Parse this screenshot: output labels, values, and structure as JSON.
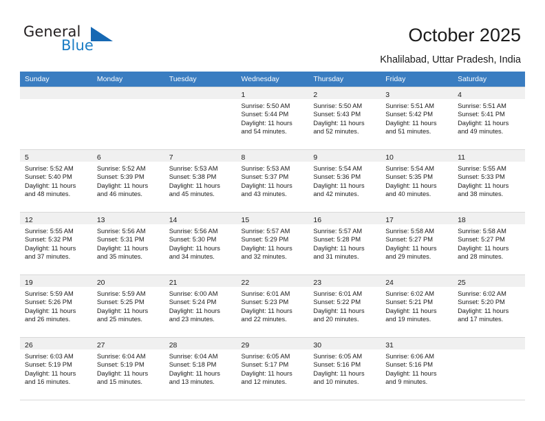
{
  "brand": {
    "general_text": "General",
    "blue_text": "Blue",
    "triangle_icon": "triangle-icon",
    "accent_color": "#1668b3"
  },
  "header": {
    "title": "October 2025",
    "location": "Khalilabad, Uttar Pradesh, India",
    "header_bg_color": "#3a7dc1"
  },
  "calendar": {
    "weekdays": [
      "Sunday",
      "Monday",
      "Tuesday",
      "Wednesday",
      "Thursday",
      "Friday",
      "Saturday"
    ],
    "labels": {
      "sunrise": "Sunrise:",
      "sunset": "Sunset:",
      "daylight": "Daylight:"
    },
    "weeks": [
      [
        {
          "day": "",
          "sunrise": "",
          "sunset": "",
          "daylight_1": "",
          "daylight_2": ""
        },
        {
          "day": "",
          "sunrise": "",
          "sunset": "",
          "daylight_1": "",
          "daylight_2": ""
        },
        {
          "day": "",
          "sunrise": "",
          "sunset": "",
          "daylight_1": "",
          "daylight_2": ""
        },
        {
          "day": "1",
          "sunrise": "Sunrise: 5:50 AM",
          "sunset": "Sunset: 5:44 PM",
          "daylight_1": "Daylight: 11 hours",
          "daylight_2": "and 54 minutes."
        },
        {
          "day": "2",
          "sunrise": "Sunrise: 5:50 AM",
          "sunset": "Sunset: 5:43 PM",
          "daylight_1": "Daylight: 11 hours",
          "daylight_2": "and 52 minutes."
        },
        {
          "day": "3",
          "sunrise": "Sunrise: 5:51 AM",
          "sunset": "Sunset: 5:42 PM",
          "daylight_1": "Daylight: 11 hours",
          "daylight_2": "and 51 minutes."
        },
        {
          "day": "4",
          "sunrise": "Sunrise: 5:51 AM",
          "sunset": "Sunset: 5:41 PM",
          "daylight_1": "Daylight: 11 hours",
          "daylight_2": "and 49 minutes."
        }
      ],
      [
        {
          "day": "5",
          "sunrise": "Sunrise: 5:52 AM",
          "sunset": "Sunset: 5:40 PM",
          "daylight_1": "Daylight: 11 hours",
          "daylight_2": "and 48 minutes."
        },
        {
          "day": "6",
          "sunrise": "Sunrise: 5:52 AM",
          "sunset": "Sunset: 5:39 PM",
          "daylight_1": "Daylight: 11 hours",
          "daylight_2": "and 46 minutes."
        },
        {
          "day": "7",
          "sunrise": "Sunrise: 5:53 AM",
          "sunset": "Sunset: 5:38 PM",
          "daylight_1": "Daylight: 11 hours",
          "daylight_2": "and 45 minutes."
        },
        {
          "day": "8",
          "sunrise": "Sunrise: 5:53 AM",
          "sunset": "Sunset: 5:37 PM",
          "daylight_1": "Daylight: 11 hours",
          "daylight_2": "and 43 minutes."
        },
        {
          "day": "9",
          "sunrise": "Sunrise: 5:54 AM",
          "sunset": "Sunset: 5:36 PM",
          "daylight_1": "Daylight: 11 hours",
          "daylight_2": "and 42 minutes."
        },
        {
          "day": "10",
          "sunrise": "Sunrise: 5:54 AM",
          "sunset": "Sunset: 5:35 PM",
          "daylight_1": "Daylight: 11 hours",
          "daylight_2": "and 40 minutes."
        },
        {
          "day": "11",
          "sunrise": "Sunrise: 5:55 AM",
          "sunset": "Sunset: 5:33 PM",
          "daylight_1": "Daylight: 11 hours",
          "daylight_2": "and 38 minutes."
        }
      ],
      [
        {
          "day": "12",
          "sunrise": "Sunrise: 5:55 AM",
          "sunset": "Sunset: 5:32 PM",
          "daylight_1": "Daylight: 11 hours",
          "daylight_2": "and 37 minutes."
        },
        {
          "day": "13",
          "sunrise": "Sunrise: 5:56 AM",
          "sunset": "Sunset: 5:31 PM",
          "daylight_1": "Daylight: 11 hours",
          "daylight_2": "and 35 minutes."
        },
        {
          "day": "14",
          "sunrise": "Sunrise: 5:56 AM",
          "sunset": "Sunset: 5:30 PM",
          "daylight_1": "Daylight: 11 hours",
          "daylight_2": "and 34 minutes."
        },
        {
          "day": "15",
          "sunrise": "Sunrise: 5:57 AM",
          "sunset": "Sunset: 5:29 PM",
          "daylight_1": "Daylight: 11 hours",
          "daylight_2": "and 32 minutes."
        },
        {
          "day": "16",
          "sunrise": "Sunrise: 5:57 AM",
          "sunset": "Sunset: 5:28 PM",
          "daylight_1": "Daylight: 11 hours",
          "daylight_2": "and 31 minutes."
        },
        {
          "day": "17",
          "sunrise": "Sunrise: 5:58 AM",
          "sunset": "Sunset: 5:27 PM",
          "daylight_1": "Daylight: 11 hours",
          "daylight_2": "and 29 minutes."
        },
        {
          "day": "18",
          "sunrise": "Sunrise: 5:58 AM",
          "sunset": "Sunset: 5:27 PM",
          "daylight_1": "Daylight: 11 hours",
          "daylight_2": "and 28 minutes."
        }
      ],
      [
        {
          "day": "19",
          "sunrise": "Sunrise: 5:59 AM",
          "sunset": "Sunset: 5:26 PM",
          "daylight_1": "Daylight: 11 hours",
          "daylight_2": "and 26 minutes."
        },
        {
          "day": "20",
          "sunrise": "Sunrise: 5:59 AM",
          "sunset": "Sunset: 5:25 PM",
          "daylight_1": "Daylight: 11 hours",
          "daylight_2": "and 25 minutes."
        },
        {
          "day": "21",
          "sunrise": "Sunrise: 6:00 AM",
          "sunset": "Sunset: 5:24 PM",
          "daylight_1": "Daylight: 11 hours",
          "daylight_2": "and 23 minutes."
        },
        {
          "day": "22",
          "sunrise": "Sunrise: 6:01 AM",
          "sunset": "Sunset: 5:23 PM",
          "daylight_1": "Daylight: 11 hours",
          "daylight_2": "and 22 minutes."
        },
        {
          "day": "23",
          "sunrise": "Sunrise: 6:01 AM",
          "sunset": "Sunset: 5:22 PM",
          "daylight_1": "Daylight: 11 hours",
          "daylight_2": "and 20 minutes."
        },
        {
          "day": "24",
          "sunrise": "Sunrise: 6:02 AM",
          "sunset": "Sunset: 5:21 PM",
          "daylight_1": "Daylight: 11 hours",
          "daylight_2": "and 19 minutes."
        },
        {
          "day": "25",
          "sunrise": "Sunrise: 6:02 AM",
          "sunset": "Sunset: 5:20 PM",
          "daylight_1": "Daylight: 11 hours",
          "daylight_2": "and 17 minutes."
        }
      ],
      [
        {
          "day": "26",
          "sunrise": "Sunrise: 6:03 AM",
          "sunset": "Sunset: 5:19 PM",
          "daylight_1": "Daylight: 11 hours",
          "daylight_2": "and 16 minutes."
        },
        {
          "day": "27",
          "sunrise": "Sunrise: 6:04 AM",
          "sunset": "Sunset: 5:19 PM",
          "daylight_1": "Daylight: 11 hours",
          "daylight_2": "and 15 minutes."
        },
        {
          "day": "28",
          "sunrise": "Sunrise: 6:04 AM",
          "sunset": "Sunset: 5:18 PM",
          "daylight_1": "Daylight: 11 hours",
          "daylight_2": "and 13 minutes."
        },
        {
          "day": "29",
          "sunrise": "Sunrise: 6:05 AM",
          "sunset": "Sunset: 5:17 PM",
          "daylight_1": "Daylight: 11 hours",
          "daylight_2": "and 12 minutes."
        },
        {
          "day": "30",
          "sunrise": "Sunrise: 6:05 AM",
          "sunset": "Sunset: 5:16 PM",
          "daylight_1": "Daylight: 11 hours",
          "daylight_2": "and 10 minutes."
        },
        {
          "day": "31",
          "sunrise": "Sunrise: 6:06 AM",
          "sunset": "Sunset: 5:16 PM",
          "daylight_1": "Daylight: 11 hours",
          "daylight_2": "and 9 minutes."
        },
        {
          "day": "",
          "sunrise": "",
          "sunset": "",
          "daylight_1": "",
          "daylight_2": ""
        }
      ]
    ]
  }
}
